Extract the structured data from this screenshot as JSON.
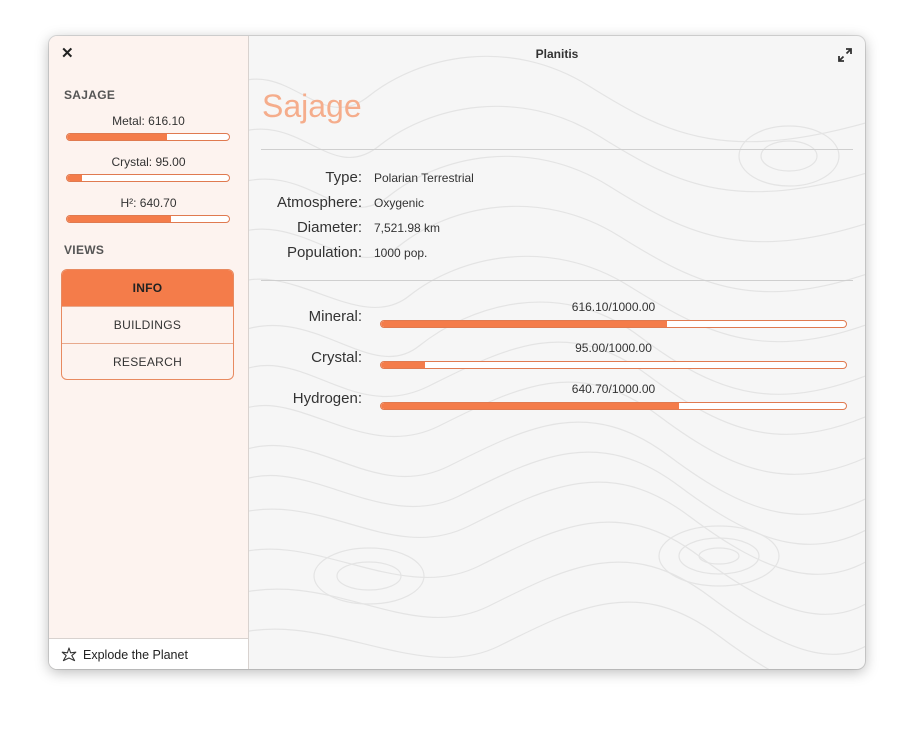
{
  "window": {
    "title": "Planitis"
  },
  "sidebar": {
    "planet_heading": "SAJAGE",
    "resources": [
      {
        "label": "Metal: 616.10",
        "fraction": 0.6161
      },
      {
        "label": "Crystal: 95.00",
        "fraction": 0.095
      },
      {
        "label": "H²: 640.70",
        "fraction": 0.6407
      }
    ],
    "views_heading": "VIEWS",
    "views": [
      {
        "label": "INFO",
        "active": true
      },
      {
        "label": "BUILDINGS",
        "active": false
      },
      {
        "label": "RESEARCH",
        "active": false
      }
    ],
    "explode_label": "Explode the Planet"
  },
  "main": {
    "planet_name": "Sajage",
    "info": [
      {
        "label": "Type:",
        "value": "Polarian Terrestrial"
      },
      {
        "label": "Atmosphere:",
        "value": "Oxygenic"
      },
      {
        "label": "Diameter:",
        "value": "7,521.98 km"
      },
      {
        "label": "Population:",
        "value": "1000 pop."
      }
    ],
    "resources": [
      {
        "label": "Mineral:",
        "value_text": "616.10/1000.00",
        "fraction": 0.6161
      },
      {
        "label": "Crystal:",
        "value_text": "95.00/1000.00",
        "fraction": 0.095
      },
      {
        "label": "Hydrogen:",
        "value_text": "640.70/1000.00",
        "fraction": 0.6407
      }
    ]
  },
  "colors": {
    "accent": "#f47c4a",
    "accent_light": "#f5ad8c",
    "sidebar_bg": "#fdf3ef"
  },
  "icons": {
    "close": "close-icon",
    "expand": "expand-icon",
    "explode": "star-burst-icon"
  }
}
